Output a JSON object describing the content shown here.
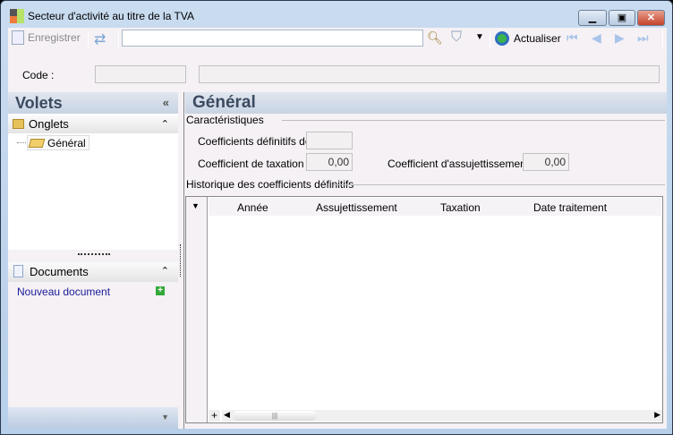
{
  "window": {
    "title": "Secteur d'activité au titre de la TVA"
  },
  "toolbar": {
    "save_label": "Enregistrer",
    "search_value": "",
    "refresh_label": "Actualiser"
  },
  "code_row": {
    "label": "Code :",
    "code_value": "",
    "description_value": ""
  },
  "left_panel": {
    "title": "Volets",
    "tabs_section": {
      "title": "Onglets",
      "items": [
        {
          "label": "Général"
        }
      ]
    },
    "documents_section": {
      "title": "Documents",
      "new_document": "Nouveau document"
    }
  },
  "main": {
    "title": "Général",
    "characteristics": {
      "legend": "Caractéristiques",
      "coef_definitifs_label": "Coefficients définitifs de :",
      "coef_definitifs_value": "",
      "taxation_label": "Coefficient de taxation :",
      "taxation_value": "0,00",
      "assujettissement_label": "Coefficient d'assujettissement :",
      "assujettissement_value": "0,00"
    },
    "history": {
      "legend": "Historique des coefficients définitifs",
      "columns": [
        "Année",
        "Assujettissement",
        "Taxation",
        "Date traitement"
      ],
      "rows": []
    }
  }
}
